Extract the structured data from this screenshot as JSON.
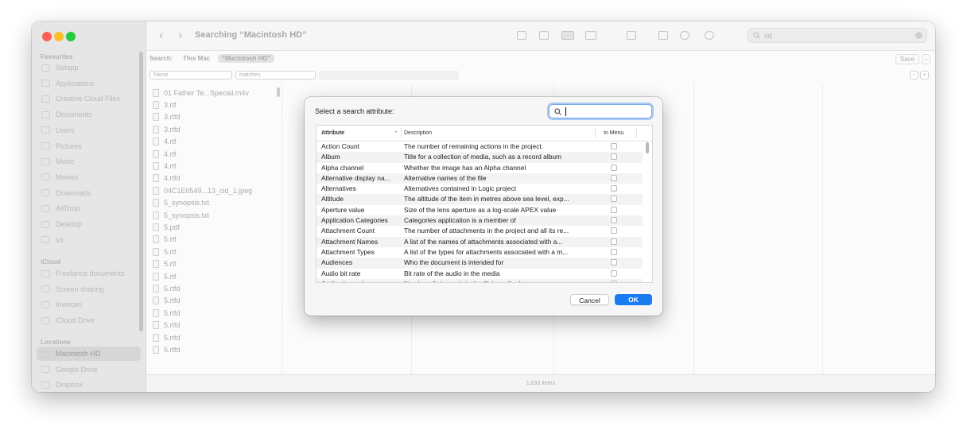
{
  "window": {
    "title": "Searching “Macintosh HD”"
  },
  "sidebar": {
    "favourites_label": "Favourites",
    "favourites": [
      "Setapp",
      "Applications",
      "Creative Cloud Files",
      "Documents",
      "Users",
      "Pictures",
      "Music",
      "Movies",
      "Downloads",
      "AirDrop",
      "Desktop",
      "sd"
    ],
    "icloud_label": "iCloud",
    "icloud": [
      "Freelance documents",
      "Screen sharing",
      "Invoices",
      "iCloud Drive"
    ],
    "locations_label": "Locations",
    "locations": [
      "Macintosh HD",
      "Google Drive",
      "Dropbox"
    ],
    "selected": "Macintosh HD"
  },
  "toolbar": {
    "search_value": "sd"
  },
  "scope": {
    "label": "Search:",
    "this_mac": "This Mac",
    "selected": "“Macintosh HD”",
    "save": "Save"
  },
  "criteria": {
    "attribute": "Name",
    "operator": "matches"
  },
  "files": [
    "01 Father Te...Special.m4v",
    "3.rtf",
    "3.rtfd",
    "3.rtfd",
    "4.rtf",
    "4.rtf",
    "4.rtf",
    "4.rtfd",
    "04C1E0549...13_cid_1.jpeg",
    "5_synopsis.txt",
    "5_synopsis.txt",
    "5.pdf",
    "5.rtf",
    "5.rtf",
    "5.rtf",
    "5.rtf",
    "5.rtfd",
    "5.rtfd",
    "5.rtfd",
    "5.rtfd",
    "5.rtfd",
    "5.rtfd"
  ],
  "status": {
    "count": "1,033 items"
  },
  "dialog": {
    "title": "Select a search attribute:",
    "search_value": "",
    "columns": {
      "attribute": "Attribute",
      "description": "Description",
      "in_menu": "In Menu"
    },
    "rows": [
      {
        "attr": "Action Count",
        "desc": "The number of remaining actions in the project."
      },
      {
        "attr": "Album",
        "desc": "Title for a collection of media, such as a record album"
      },
      {
        "attr": "Alpha channel",
        "desc": "Whether the image has an Alpha channel"
      },
      {
        "attr": "Alternative display na...",
        "desc": "Alternative names of the file"
      },
      {
        "attr": "Alternatives",
        "desc": "Alternatives contained in Logic project"
      },
      {
        "attr": "Altitude",
        "desc": "The altitude of the item in metres above sea level, exp..."
      },
      {
        "attr": "Aperture value",
        "desc": "Size of the lens aperture as a log-scale APEX value"
      },
      {
        "attr": "Application Categories",
        "desc": "Categories application is a member of"
      },
      {
        "attr": "Attachment Count",
        "desc": "The number of attachments in the project and all its re..."
      },
      {
        "attr": "Attachment Names",
        "desc": "A list of the names of attachments associated with a..."
      },
      {
        "attr": "Attachment Types",
        "desc": "A list of the types for attachments associated with a m..."
      },
      {
        "attr": "Audiences",
        "desc": "Who the document is intended for"
      },
      {
        "attr": "Audio bit rate",
        "desc": "Bit rate of the audio in the media"
      },
      {
        "attr": "Audio channels",
        "desc": "Number of channels in the file's audio data"
      }
    ],
    "cancel_label": "Cancel",
    "ok_label": "OK"
  },
  "colors": {
    "accent": "#1a7cf2",
    "close": "#ff5f57",
    "minimize": "#febc2e",
    "zoom": "#28c840"
  }
}
